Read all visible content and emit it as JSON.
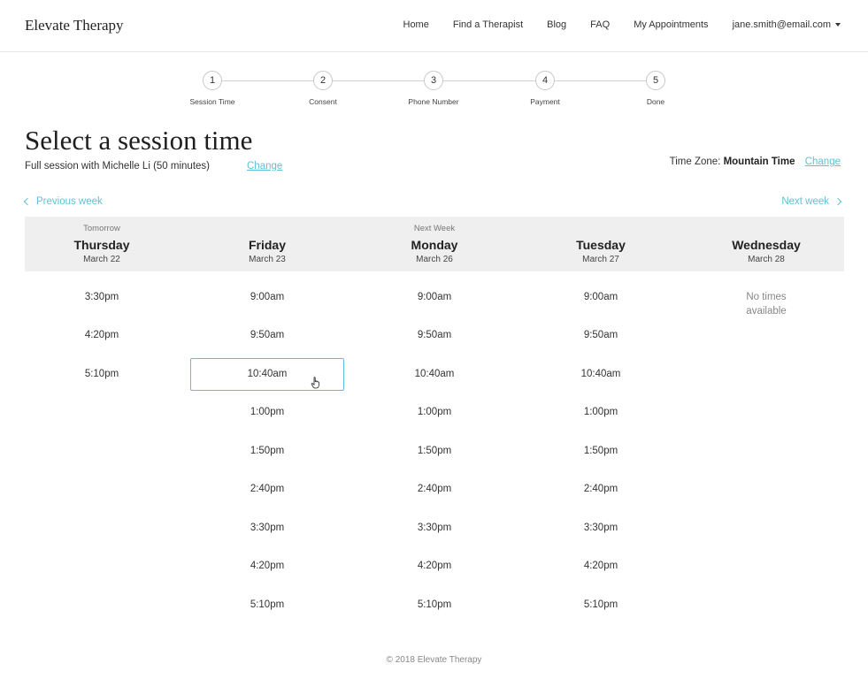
{
  "header": {
    "logo": "Elevate Therapy",
    "nav": [
      "Home",
      "Find a Therapist",
      "Blog",
      "FAQ",
      "My Appointments"
    ],
    "user_email": "jane.smith@email.com"
  },
  "stepper": {
    "steps": [
      {
        "number": "1",
        "label": "Session Time"
      },
      {
        "number": "2",
        "label": "Consent"
      },
      {
        "number": "3",
        "label": "Phone Number"
      },
      {
        "number": "4",
        "label": "Payment"
      },
      {
        "number": "5",
        "label": "Done"
      }
    ]
  },
  "page": {
    "title": "Select a session time",
    "subtitle": "Full session with Michelle Li (50 minutes)",
    "change_label": "Change",
    "timezone_label": "Time Zone:",
    "timezone_value": "Mountain Time",
    "timezone_change": "Change"
  },
  "week_nav": {
    "previous": "Previous week",
    "next": "Next week"
  },
  "days": [
    {
      "tag": "Tomorrow",
      "name": "Thursday",
      "date": "March 22",
      "slots": [
        "3:30pm",
        "4:20pm",
        "5:10pm"
      ]
    },
    {
      "tag": "",
      "name": "Friday",
      "date": "March 23",
      "slots": [
        "9:00am",
        "9:50am",
        "10:40am",
        "1:00pm",
        "1:50pm",
        "2:40pm",
        "3:30pm",
        "4:20pm",
        "5:10pm"
      ]
    },
    {
      "tag": "Next Week",
      "name": "Monday",
      "date": "March 26",
      "slots": [
        "9:00am",
        "9:50am",
        "10:40am",
        "1:00pm",
        "1:50pm",
        "2:40pm",
        "3:30pm",
        "4:20pm",
        "5:10pm"
      ]
    },
    {
      "tag": "",
      "name": "Tuesday",
      "date": "March 27",
      "slots": [
        "9:00am",
        "9:50am",
        "10:40am",
        "1:00pm",
        "1:50pm",
        "2:40pm",
        "3:30pm",
        "4:20pm",
        "5:10pm"
      ]
    },
    {
      "tag": "",
      "name": "Wednesday",
      "date": "March 28",
      "slots": [],
      "empty_text": [
        "No times",
        "available"
      ]
    }
  ],
  "selected_slot": {
    "day": "Friday",
    "time": "10:40am"
  },
  "colors": {
    "accent": "#5ec2d6",
    "header_bg": "#efefef"
  },
  "footer": "© 2018 Elevate Therapy"
}
